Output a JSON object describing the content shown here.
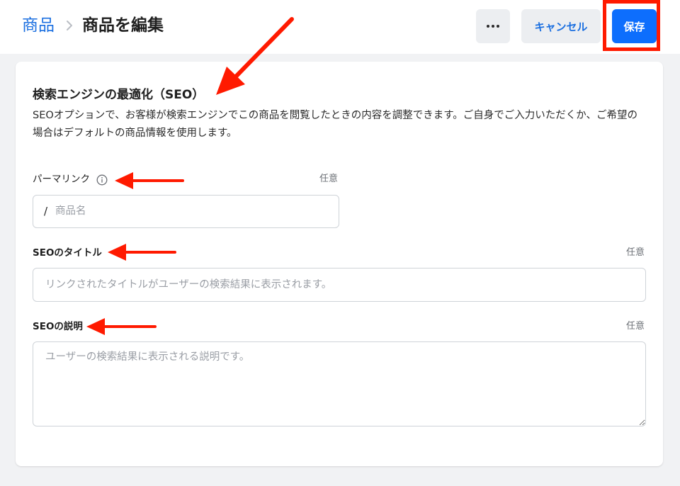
{
  "header": {
    "breadcrumb_parent": "商品",
    "title": "商品を編集",
    "more_icon": "ellipsis-icon",
    "cancel_label": "キャンセル",
    "save_label": "保存"
  },
  "seo": {
    "title": "検索エンジンの最適化（SEO）",
    "description": "SEOオプションで、お客様が検索エンジンでこの商品を閲覧したときの内容を調整できます。ご自身でご入力いただくか、ご希望の場合はデフォルトの商品情報を使用します。",
    "permalink": {
      "label": "パーマリンク",
      "optional": "任意",
      "prefix": "/",
      "placeholder": "商品名",
      "icon": "info-icon"
    },
    "seo_title": {
      "label": "SEOのタイトル",
      "optional": "任意",
      "placeholder": "リンクされたタイトルがユーザーの検索結果に表示されます。"
    },
    "seo_description": {
      "label": "SEOの説明",
      "optional": "任意",
      "placeholder": "ユーザーの検索結果に表示される説明です。"
    }
  },
  "colors": {
    "accent": "#1b6fe0",
    "primary_button": "#0d6efd",
    "annotation": "#ff1a00"
  }
}
